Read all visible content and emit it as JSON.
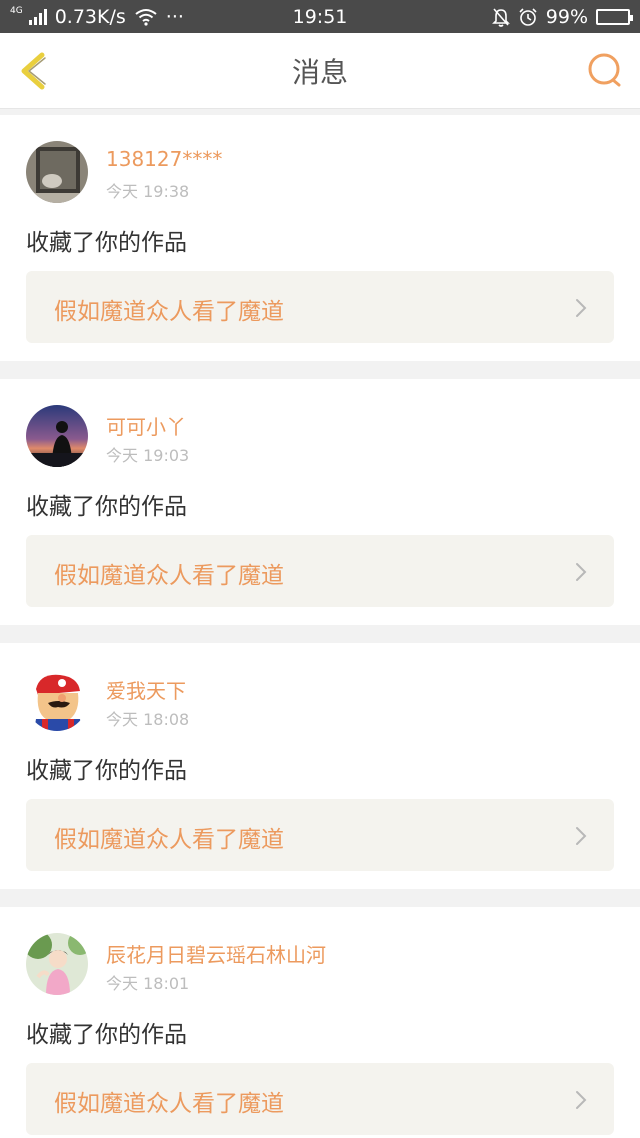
{
  "status_bar": {
    "network_tag": "4G",
    "speed": "0.73K/s",
    "more": "···",
    "time": "19:51",
    "battery": "99%",
    "icons": [
      "signal-icon",
      "wifi-icon",
      "mute-icon",
      "alarm-icon",
      "battery-icon"
    ]
  },
  "header": {
    "title": "消息",
    "back_icon": "chevron-left-icon",
    "search_icon": "search-icon"
  },
  "colors": {
    "accent": "#ec9a5e",
    "back_icon": "#e9cf3e",
    "action_text": "#333333",
    "time_text": "#bdbdbd",
    "work_box": "#f4f3ee"
  },
  "messages": [
    {
      "username": "138127****",
      "time": "今天 19:38",
      "action": "收藏了你的作品",
      "work_title": "假如魔道众人看了魔道"
    },
    {
      "username": "可可小丫",
      "time": "今天 19:03",
      "action": "收藏了你的作品",
      "work_title": "假如魔道众人看了魔道"
    },
    {
      "username": "爱我天下",
      "time": "今天 18:08",
      "action": "收藏了你的作品",
      "work_title": "假如魔道众人看了魔道"
    },
    {
      "username": "辰花月日碧云瑶石林山河",
      "time": "今天 18:01",
      "action": "收藏了你的作品",
      "work_title": "假如魔道众人看了魔道"
    }
  ]
}
